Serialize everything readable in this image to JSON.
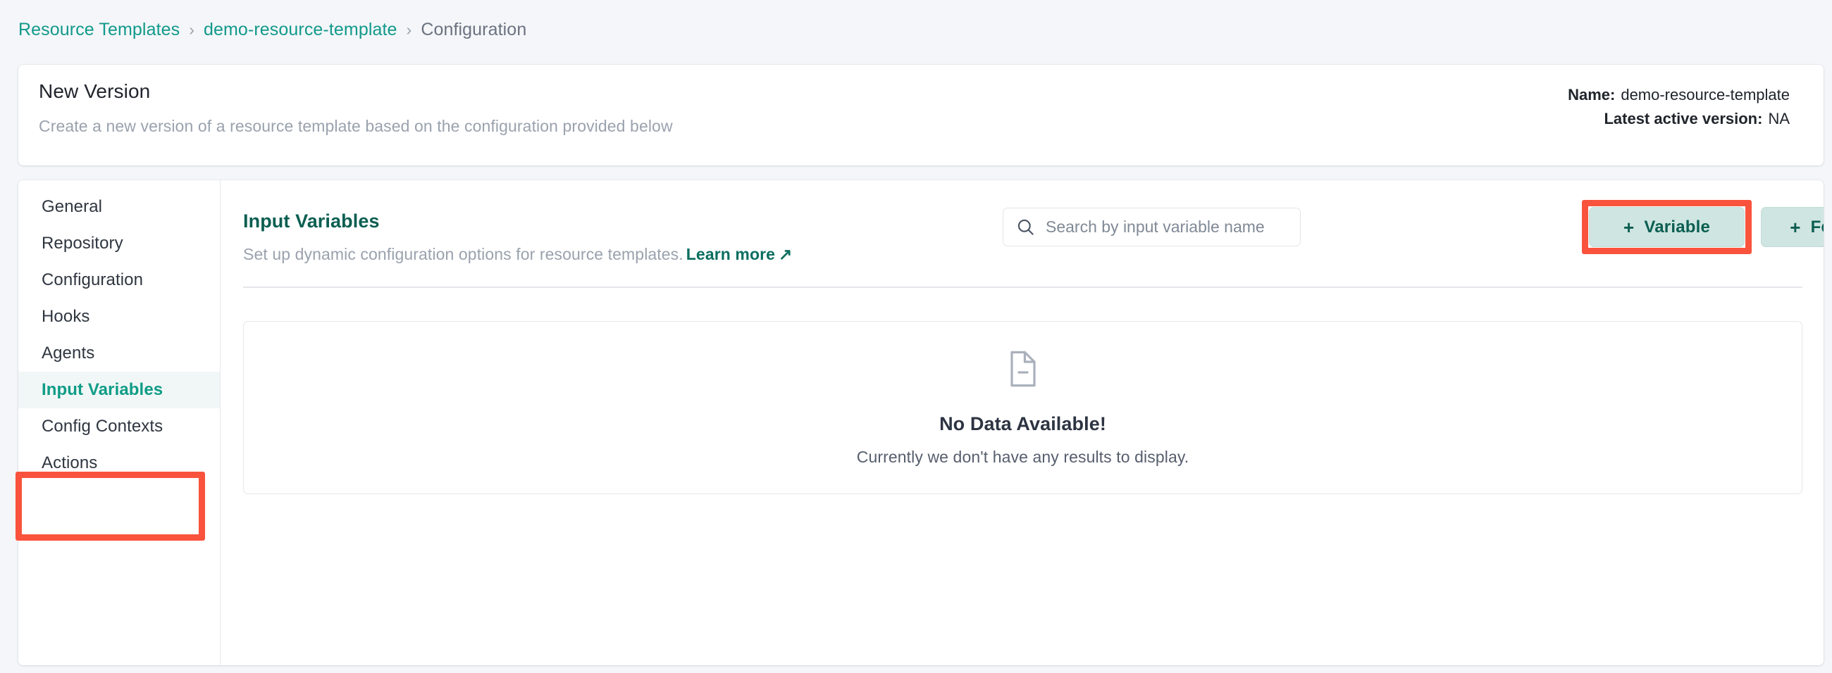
{
  "breadcrumb": {
    "items": [
      {
        "label": "Resource Templates",
        "type": "link"
      },
      {
        "label": "demo-resource-template",
        "type": "link"
      },
      {
        "label": "Configuration",
        "type": "current"
      }
    ],
    "separator": "›"
  },
  "header": {
    "title": "New Version",
    "subtitle": "Create a new version of a resource template based on the configuration provided below",
    "name_label": "Name:",
    "name_value": "demo-resource-template",
    "version_label": "Latest active version:",
    "version_value": "NA"
  },
  "sidebar": {
    "items": [
      {
        "label": "General",
        "active": false
      },
      {
        "label": "Repository",
        "active": false
      },
      {
        "label": "Configuration",
        "active": false
      },
      {
        "label": "Hooks",
        "active": false
      },
      {
        "label": "Agents",
        "active": false
      },
      {
        "label": "Input Variables",
        "active": true
      },
      {
        "label": "Config Contexts",
        "active": false
      },
      {
        "label": "Actions",
        "active": false
      }
    ]
  },
  "main": {
    "section_title": "Input Variables",
    "section_subtitle": "Set up dynamic configuration options for resource templates.",
    "learn_more_label": "Learn more",
    "learn_more_arrow": "↗",
    "search": {
      "placeholder": "Search by input variable name",
      "value": "",
      "icon": "search-icon"
    },
    "buttons": {
      "add_variable": {
        "label": "Variable",
        "prefix": "+"
      },
      "fetch_variables": {
        "label": "Fetch Variables",
        "prefix": "+"
      }
    },
    "empty_state": {
      "icon": "document-minus-icon",
      "title": "No Data Available!",
      "subtitle": "Currently we don't have any results to display."
    }
  },
  "colors": {
    "accent_teal": "#12998b",
    "accent_teal_dark": "#0b5e51",
    "button_bg": "#cfe5e1",
    "annotation_red": "#f9533d",
    "page_bg": "#f4f6f9",
    "muted_text": "#9aa2ad"
  }
}
